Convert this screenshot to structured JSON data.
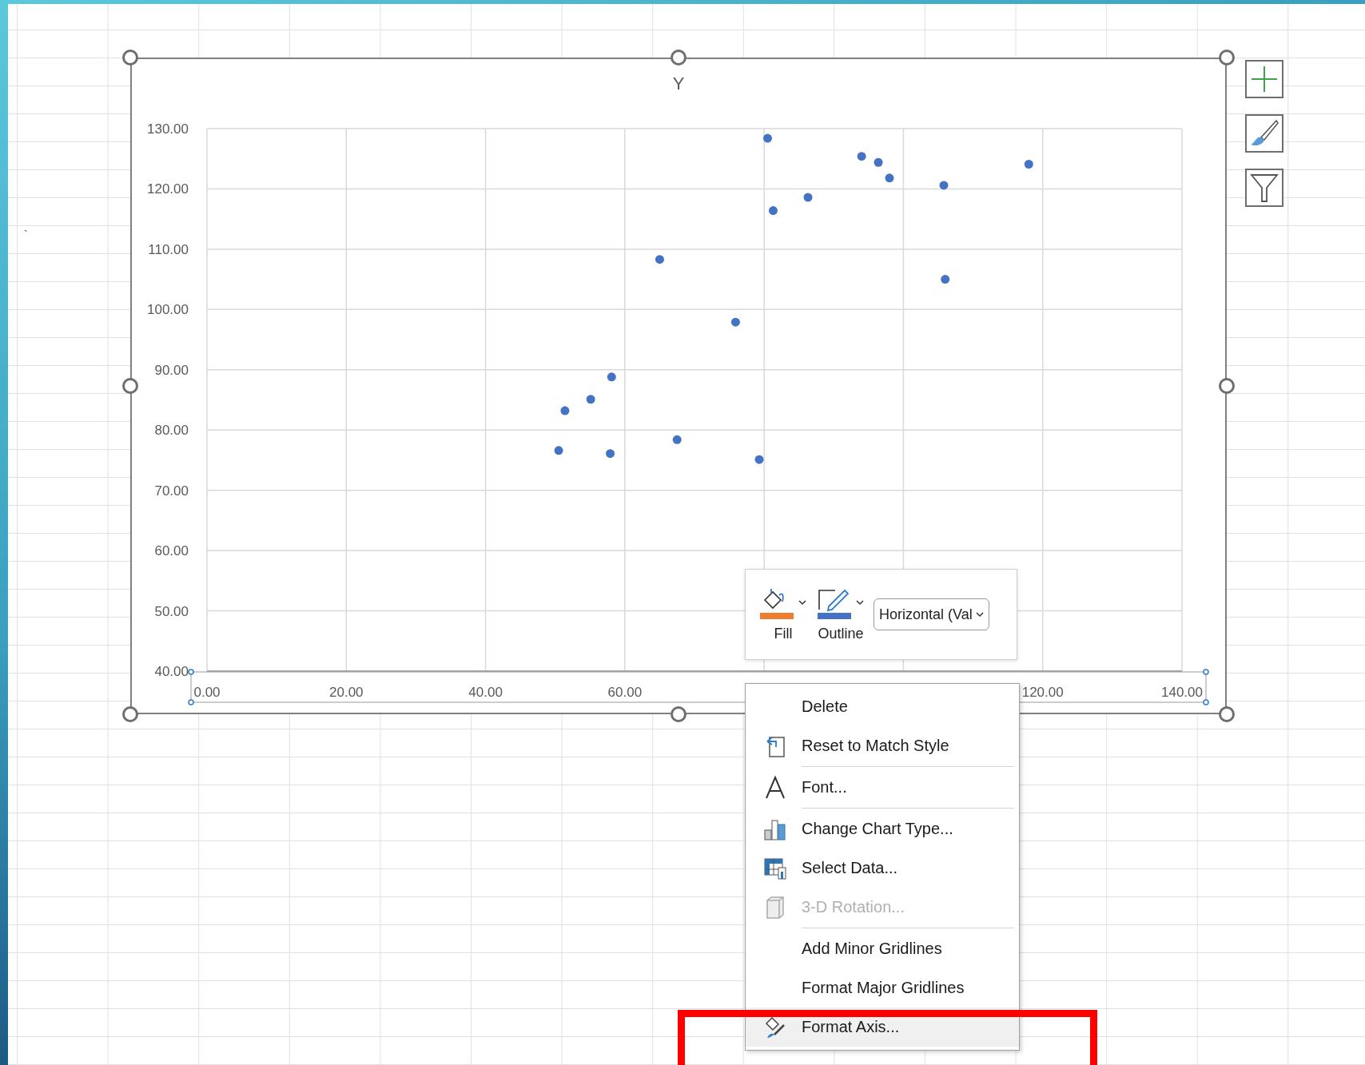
{
  "sheet": {
    "stray_mark": "`"
  },
  "chart": {
    "chart_data": {
      "type": "scatter",
      "title": "Y",
      "grid": true,
      "x": [
        80.5,
        94.0,
        96.4,
        98.0,
        105.8,
        118.0,
        81.3,
        86.3,
        65.0,
        106.0,
        75.9,
        58.1,
        55.1,
        51.4,
        50.5,
        57.9,
        67.5,
        79.3
      ],
      "series": [
        {
          "color": "#4472c4",
          "values": [
            128.4,
            125.4,
            124.4,
            121.8,
            120.6,
            124.1,
            116.4,
            118.6,
            108.3,
            105.0,
            97.9,
            88.8,
            85.1,
            83.2,
            76.6,
            76.1,
            78.4,
            75.1
          ]
        }
      ],
      "xlim": [
        0,
        140
      ],
      "ylim": [
        40,
        130
      ],
      "xticks": [
        {
          "value": 0,
          "label": "0.00"
        },
        {
          "value": 20,
          "label": "20.00"
        },
        {
          "value": 40,
          "label": "40.00"
        },
        {
          "value": 60,
          "label": "60.00"
        },
        {
          "value": 120,
          "label": "120.00"
        },
        {
          "value": 140,
          "label": "140.00"
        }
      ],
      "yticks": [
        {
          "value": 40,
          "label": "40.00"
        },
        {
          "value": 50,
          "label": "50.00"
        },
        {
          "value": 60,
          "label": "60.00"
        },
        {
          "value": 70,
          "label": "70.00"
        },
        {
          "value": 80,
          "label": "80.00"
        },
        {
          "value": 90,
          "label": "90.00"
        },
        {
          "value": 100,
          "label": "100.00"
        },
        {
          "value": 110,
          "label": "110.00"
        },
        {
          "value": 120,
          "label": "120.00"
        },
        {
          "value": 130,
          "label": "130.00"
        }
      ]
    }
  },
  "mini_toolbar": {
    "buttons": [
      {
        "label": "Fill",
        "kind": "fill",
        "color": "#ed7d31"
      },
      {
        "label": "Outline",
        "kind": "outline",
        "color": "#4472c4"
      }
    ],
    "element_picker": {
      "value": "Horizontal (Val"
    }
  },
  "context_menu": {
    "items": [
      {
        "label": "Delete",
        "kind": "plain",
        "disabled": false,
        "selected": false,
        "separator_after": false
      },
      {
        "label": "Reset to Match Style",
        "kind": "reset",
        "disabled": false,
        "selected": false,
        "separator_after": true
      },
      {
        "label": "Font...",
        "kind": "font",
        "disabled": false,
        "selected": false,
        "separator_after": true
      },
      {
        "label": "Change Chart Type...",
        "kind": "chart-type",
        "disabled": false,
        "selected": false,
        "separator_after": false
      },
      {
        "label": "Select Data...",
        "kind": "select-data",
        "disabled": false,
        "selected": false,
        "separator_after": false
      },
      {
        "label": "3-D Rotation...",
        "kind": "rotation",
        "disabled": true,
        "selected": false,
        "separator_after": true
      },
      {
        "label": "Add Minor Gridlines",
        "kind": "plain",
        "disabled": false,
        "selected": false,
        "separator_after": false
      },
      {
        "label": "Format Major Gridlines",
        "kind": "plain",
        "disabled": false,
        "selected": false,
        "separator_after": false
      },
      {
        "label": "Format Axis...",
        "kind": "format",
        "disabled": false,
        "selected": true,
        "separator_after": false
      }
    ]
  }
}
